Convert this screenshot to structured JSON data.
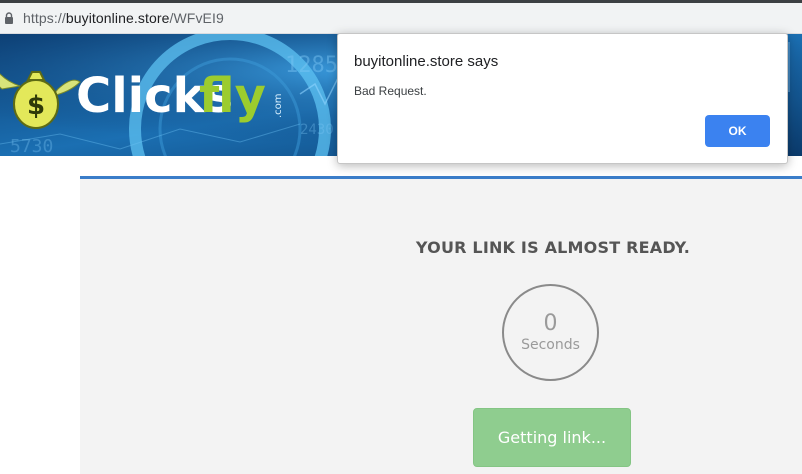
{
  "browser": {
    "url_scheme": "https://",
    "url_host": "buyitonline.store",
    "url_path": "/WFvEI9"
  },
  "banner": {
    "logo_text_a": "Clicks",
    "logo_text_b": "fly",
    "logo_suffix": ".com",
    "bg_digits_a": "1285",
    "bg_digits_b": "5730",
    "bg_digits_c": "2430"
  },
  "main": {
    "title": "YOUR LINK IS ALMOST READY.",
    "countdown_value": "0",
    "countdown_label": "Seconds",
    "button_label": "Getting link..."
  },
  "dialog": {
    "title": "buyitonline.store says",
    "message": "Bad Request.",
    "ok_label": "OK"
  },
  "colors": {
    "panel_border": "#3a7dc9",
    "button_green": "#8fcd8f",
    "dialog_ok": "#3b82f0"
  }
}
